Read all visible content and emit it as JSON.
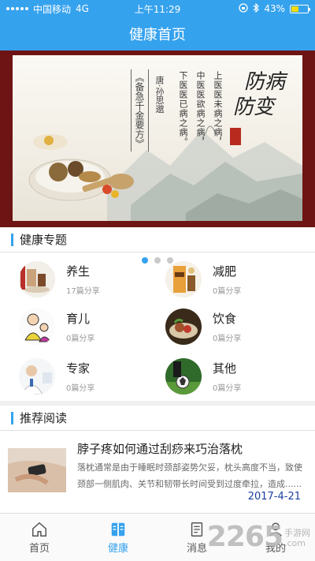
{
  "status_bar": {
    "carrier": "中国移动",
    "network": "4G",
    "time": "上午11:29",
    "battery": "43%",
    "battery_level": 0.43
  },
  "nav": {
    "title": "健康首页"
  },
  "banner": {
    "calligraphy_1": "防病",
    "calligraphy_2": "防变",
    "poem_lines": [
      "上医医未病之病，",
      "中医医欲病之病，",
      "下医医已病之病。"
    ],
    "author": "唐·孙思邈",
    "book": "《备急千金要方》",
    "slide_count": 3,
    "active_slide": 0
  },
  "health_topics": {
    "header": "健康专题",
    "items": [
      {
        "title": "养生",
        "sub": "17篇分享",
        "icon": "tea-set-thumbnail"
      },
      {
        "title": "减肥",
        "sub": "0篇分享",
        "icon": "slimming-product-thumbnail"
      },
      {
        "title": "育儿",
        "sub": "0篇分享",
        "icon": "parenting-cartoon-thumbnail"
      },
      {
        "title": "饮食",
        "sub": "0篇分享",
        "icon": "food-dish-thumbnail"
      },
      {
        "title": "专家",
        "sub": "0篇分享",
        "icon": "doctor-thumbnail"
      },
      {
        "title": "其他",
        "sub": "0篇分享",
        "icon": "sports-thumbnail"
      }
    ]
  },
  "recommended": {
    "header": "推荐阅读",
    "articles": [
      {
        "title": "脖子疼如何通过刮痧来巧治落枕",
        "summary": "落枕通常是由于睡眠时颈部姿势欠妥，枕头高度不当，致使颈部一侧肌肉、关节和韧带长时间受到过度牵拉，造成......",
        "date": "2017-4-21"
      }
    ]
  },
  "tab_bar": {
    "tabs": [
      {
        "label": "首页",
        "icon": "home-icon",
        "active": false
      },
      {
        "label": "健康",
        "icon": "health-book-icon",
        "active": true
      },
      {
        "label": "消息",
        "icon": "message-icon",
        "active": false
      },
      {
        "label": "我的",
        "icon": "user-icon",
        "active": false
      }
    ]
  },
  "watermark": {
    "number": "2265",
    "site_top": "手游网",
    "site_bottom": ".com"
  },
  "colors": {
    "primary": "#35a2ee",
    "date": "#1a3fa0",
    "banner_frame": "#6f1414"
  }
}
